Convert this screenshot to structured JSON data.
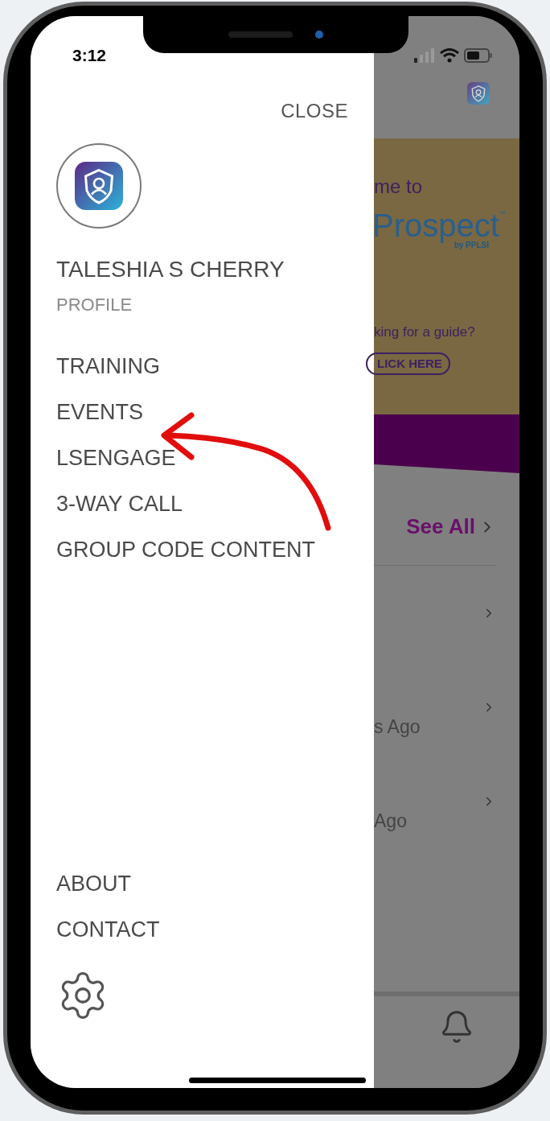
{
  "status_bar": {
    "time": "3:12"
  },
  "drawer": {
    "close": "CLOSE",
    "user_name": "TALESHIA S CHERRY",
    "profile": "PROFILE",
    "menu": [
      "TRAINING",
      "EVENTS",
      "LSENGAGE",
      "3-WAY CALL",
      "GROUP CODE CONTENT"
    ],
    "footer": [
      "ABOUT",
      "CONTACT"
    ]
  },
  "background": {
    "banner": {
      "line_1": "me to",
      "brand": "Prospect",
      "brand_tm": "™",
      "brand_by": "by PPLSI",
      "line_2": "king for a guide?",
      "button": "LICK HERE"
    },
    "see_all": "See All",
    "rows": [
      {},
      {
        "time": "s Ago"
      },
      {
        "time": "Ago"
      }
    ]
  }
}
